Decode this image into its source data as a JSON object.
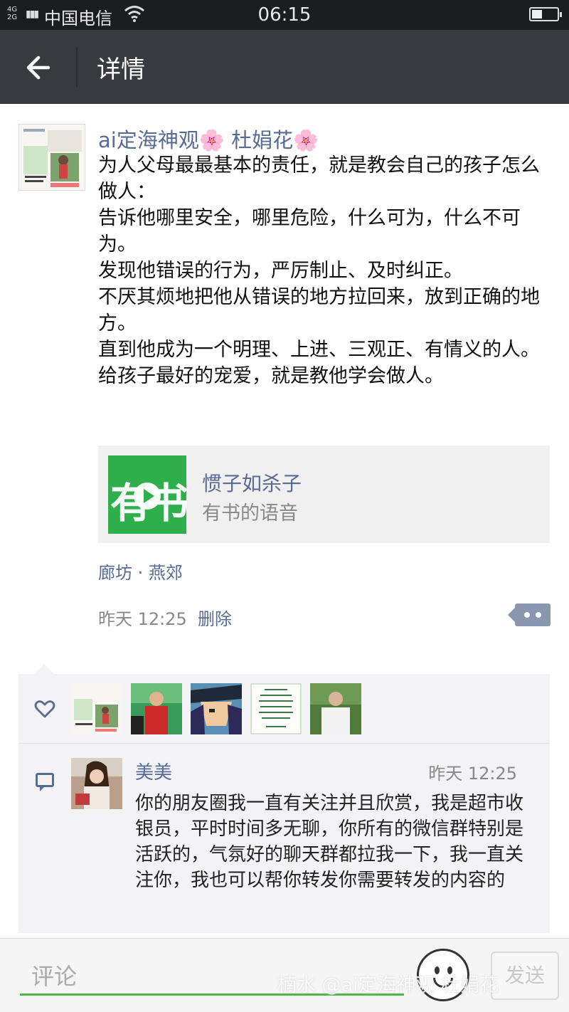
{
  "status_bar": {
    "network": "4G 2G",
    "carrier": "中国电信",
    "time": "06:15",
    "battery_level": 0.4
  },
  "header": {
    "title": "详情",
    "back_icon": "arrow-left-icon"
  },
  "post": {
    "author": "ai定海神观🌸 杜娟花🌸",
    "text": "为人父母最最基本的责任，就是教会自己的孩子怎么做人：\n告诉他哪里安全，哪里危险，什么可为，什么不可为。\n发现他错误的行为，严厉制止、及时纠正。\n不厌其烦地把他从错误的地方拉回来，放到正确的地方。\n直到他成为一个明理、上进、三观正、有情义的人。\n给孩子最好的宠爱，就是教他学会做人。",
    "link_card": {
      "title": "惯子如杀子",
      "subtitle": "有书的语音",
      "thumb_logo": "有书",
      "thumb_color": "#2fae4c"
    },
    "location": "廊坊 · 燕郊",
    "time": "昨天 12:25",
    "delete_label": "删除"
  },
  "likes": {
    "icon": "heart-icon",
    "avatar_count": 5
  },
  "comments": [
    {
      "name": "美美",
      "time": "昨天 12:25",
      "text": "你的朋友圈我一直有关注并且欣赏，我是超市收银员，平时时间多无聊，你所有的微信群特别是活跃的，气氛好的聊天群都拉我一下，我一直关注你，我也可以帮你转发你需要转发的内容的"
    }
  ],
  "bottom_bar": {
    "input_placeholder": "评论",
    "send_label": "发送",
    "emoji_icon": "smiley-icon"
  },
  "watermark": "楠水 @ai定海神观 杜娟花",
  "colors": {
    "link_blue": "#576b95",
    "titlebar": "#393a3f",
    "statusbar": "#1c1d20",
    "panel_bg": "#f3f3f5",
    "input_underline": "#4bb84b"
  }
}
